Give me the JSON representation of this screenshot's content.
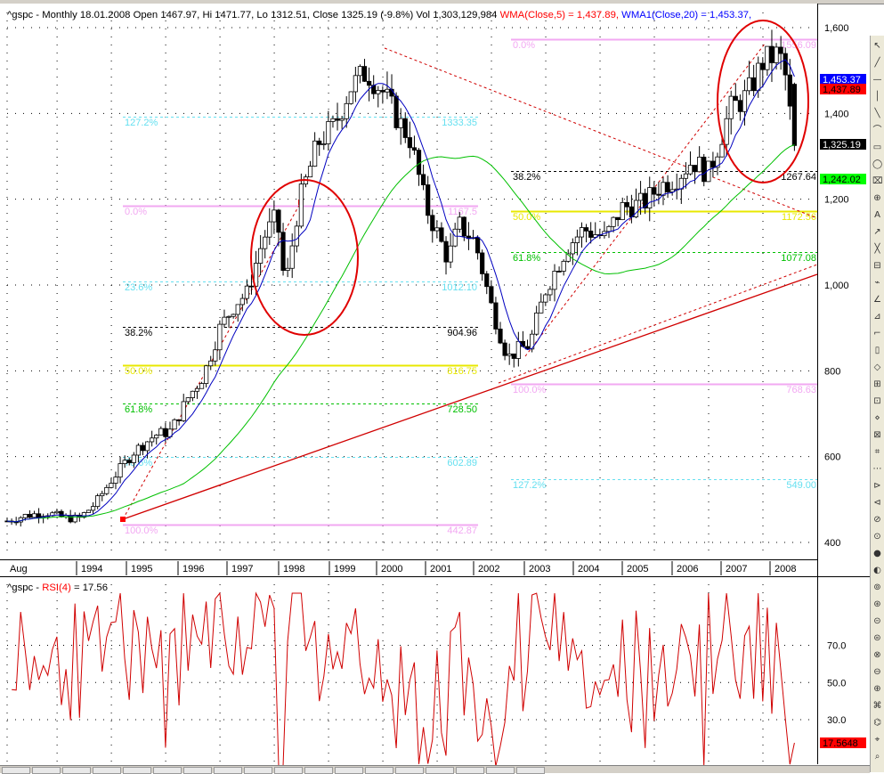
{
  "header": {
    "main_title": "^gspc - Monthly 18.01.2008 Open 1467.97, Hi 1471.77, Lo 1312.51, Close 1325.19 (-9.8%) Vol 1,303,129,984",
    "wma5": "WMA(Close,5) = 1,437.89,",
    "wma20": "WMA1(Close,20) = 1,453.37,",
    "rsi_title_prefix": "^gspc - ",
    "rsi_title_name": "RSI(4)",
    "rsi_title_value": " = 17.56"
  },
  "price_axis": [
    "1,600",
    "1,400",
    "1,200",
    "1,000",
    "800",
    "600",
    "400"
  ],
  "price_badges": [
    {
      "text": "1,453.37",
      "bg": "#0000ff",
      "fg": "#ffffff"
    },
    {
      "text": "1,437.89",
      "bg": "#ff0000",
      "fg": "#000000"
    },
    {
      "text": "1,325.19",
      "bg": "#000000",
      "fg": "#ffffff"
    },
    {
      "text": "1,242.02",
      "bg": "#00ff00",
      "fg": "#000000"
    }
  ],
  "x_axis": [
    "Aug",
    "1994",
    "1995",
    "1996",
    "1997",
    "1998",
    "1999",
    "2000",
    "2001",
    "2002",
    "2003",
    "2004",
    "2005",
    "2006",
    "2007",
    "2008"
  ],
  "rsi_axis": [
    "70.0",
    "50.0",
    "30.0"
  ],
  "rsi_badge": {
    "text": "17.5648",
    "bg": "#ff0000",
    "fg": "#000000"
  },
  "fib_left": [
    {
      "pct": "127.2%",
      "val": "1333.35",
      "color": "#66e0f0"
    },
    {
      "pct": "0.0%",
      "val": "1167.5",
      "color": "#f2a8f2"
    },
    {
      "pct": "23.6%",
      "val": "1012.10",
      "color": "#66e0f0"
    },
    {
      "pct": "38.2%",
      "val": "904.96",
      "color": "#000000"
    },
    {
      "pct": "50.0%",
      "val": "816.75",
      "color": "#e8e800"
    },
    {
      "pct": "61.8%",
      "val": "728.50",
      "color": "#00c000"
    },
    {
      "pct": "78.6%",
      "val": "602.89",
      "color": "#66e0f0"
    },
    {
      "pct": "100.0%",
      "val": "442.87",
      "color": "#f2a8f2"
    }
  ],
  "fib_right": [
    {
      "pct": "0.0%",
      "val": "1556.09",
      "color": "#f2a8f2"
    },
    {
      "pct": "38.2%",
      "val": "1267.64",
      "color": "#000000"
    },
    {
      "pct": "50.0%",
      "val": "1172.56",
      "color": "#e8e800"
    },
    {
      "pct": "61.8%",
      "val": "1077.08",
      "color": "#00c000"
    },
    {
      "pct": "100.0%",
      "val": "768.63",
      "color": "#f2a8f2"
    },
    {
      "pct": "127.2%",
      "val": "549.00",
      "color": "#66e0f0"
    }
  ],
  "chart_data": {
    "type": "line",
    "title": "^gspc - Monthly 18.01.2008",
    "y_range": [
      350,
      1620
    ],
    "x_range": [
      "1993-08",
      "2008-06"
    ],
    "ohlc_last": {
      "open": 1467.97,
      "high": 1471.77,
      "low": 1312.51,
      "close": 1325.19,
      "change_pct": -9.8,
      "volume": 1303129984
    },
    "series": [
      {
        "name": "WMA(Close,5)",
        "last": 1437.89,
        "color": "#ff0000"
      },
      {
        "name": "WMA1(Close,20)",
        "last": 1453.37,
        "color": "#0000ff"
      }
    ],
    "price_points": [
      [
        1993.58,
        450
      ],
      [
        1993.9,
        462
      ],
      [
        1994.3,
        470
      ],
      [
        1994.6,
        458
      ],
      [
        1994.9,
        455
      ],
      [
        1995.2,
        490
      ],
      [
        1995.5,
        545
      ],
      [
        1995.9,
        610
      ],
      [
        1996.3,
        650
      ],
      [
        1996.6,
        660
      ],
      [
        1996.9,
        735
      ],
      [
        1997.2,
        790
      ],
      [
        1997.5,
        900
      ],
      [
        1997.8,
        960
      ],
      [
        1998.0,
        980
      ],
      [
        1998.3,
        1110
      ],
      [
        1998.55,
        1160
      ],
      [
        1998.7,
        990
      ],
      [
        1998.95,
        1190
      ],
      [
        1999.3,
        1330
      ],
      [
        1999.6,
        1370
      ],
      [
        1999.9,
        1460
      ],
      [
        2000.2,
        1498
      ],
      [
        2000.5,
        1450
      ],
      [
        2000.8,
        1380
      ],
      [
        2001.0,
        1340
      ],
      [
        2001.3,
        1180
      ],
      [
        2001.7,
        1060
      ],
      [
        2001.9,
        1140
      ],
      [
        2002.2,
        1100
      ],
      [
        2002.5,
        950
      ],
      [
        2002.8,
        830
      ],
      [
        2003.0,
        850
      ],
      [
        2003.2,
        860
      ],
      [
        2003.5,
        990
      ],
      [
        2003.9,
        1090
      ],
      [
        2004.2,
        1130
      ],
      [
        2004.6,
        1110
      ],
      [
        2004.9,
        1180
      ],
      [
        2005.3,
        1190
      ],
      [
        2005.6,
        1230
      ],
      [
        2005.9,
        1250
      ],
      [
        2006.2,
        1290
      ],
      [
        2006.5,
        1260
      ],
      [
        2006.9,
        1410
      ],
      [
        2007.2,
        1440
      ],
      [
        2007.5,
        1520
      ],
      [
        2007.8,
        1540
      ],
      [
        2007.95,
        1468
      ],
      [
        2008.05,
        1325
      ]
    ],
    "rsi": {
      "name": "RSI(4)",
      "last": 17.56,
      "y_range": [
        0,
        100
      ],
      "levels": [
        70,
        50,
        30
      ]
    },
    "fibonacci": [
      "fib_left",
      "fib_right"
    ]
  }
}
